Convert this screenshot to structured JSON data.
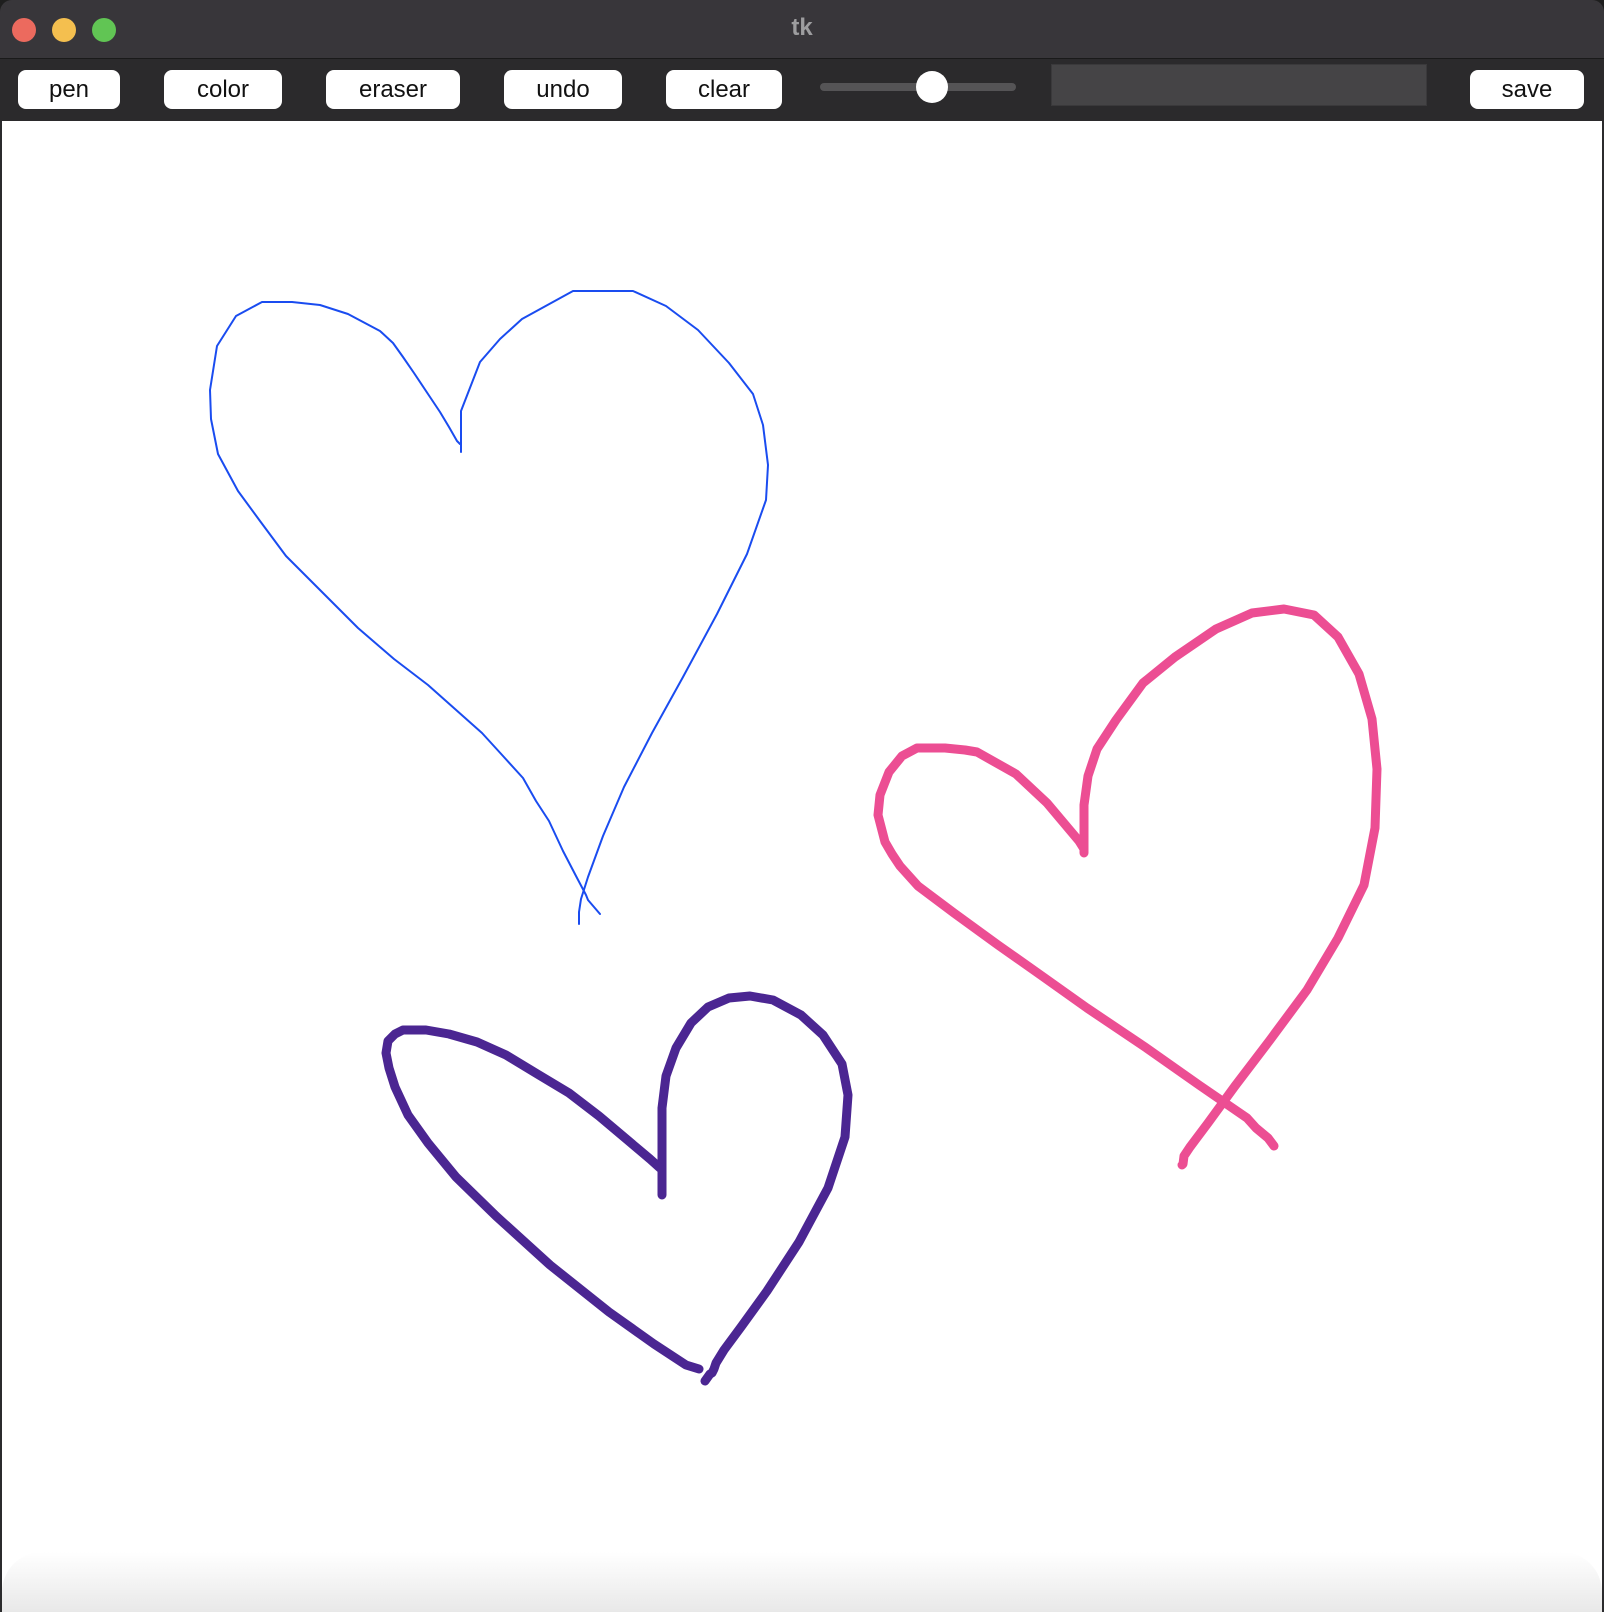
{
  "window": {
    "title": "tk"
  },
  "toolbar": {
    "pen_label": "pen",
    "color_label": "color",
    "eraser_label": "eraser",
    "undo_label": "undo",
    "clear_label": "clear",
    "save_label": "save",
    "size_slider_value": 0.57,
    "entry_value": ""
  },
  "canvas": {
    "background": "#ffffff",
    "strokes": [
      {
        "name": "blue-heart-stroke",
        "color": "#1a4cf0"
      },
      {
        "name": "pink-heart-stroke",
        "color": "#ec4e93"
      },
      {
        "name": "purple-heart-stroke",
        "color": "#4b2692"
      }
    ]
  }
}
